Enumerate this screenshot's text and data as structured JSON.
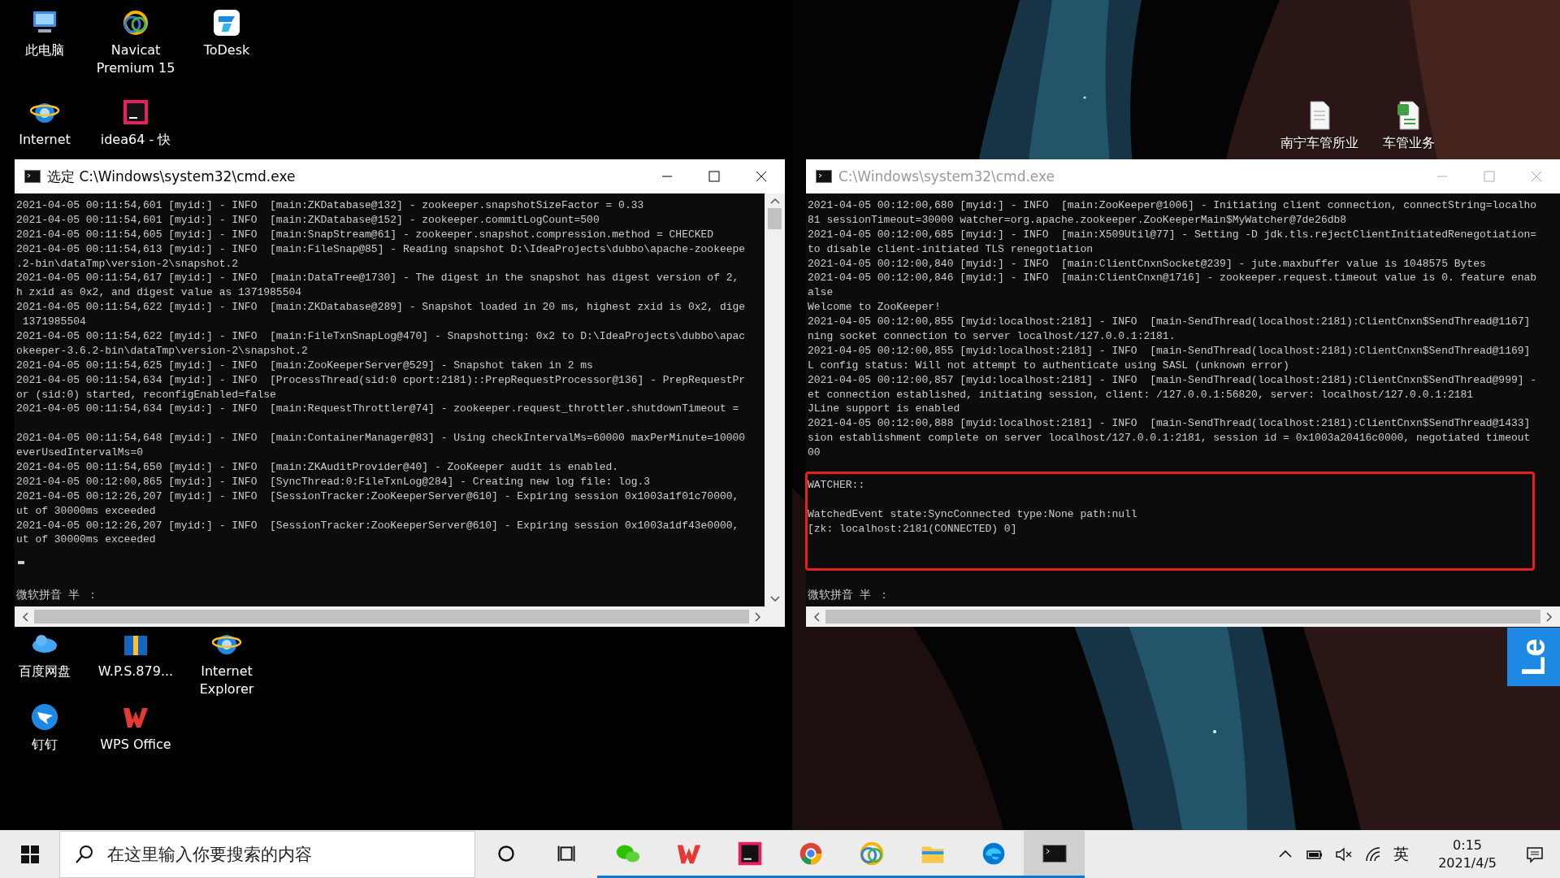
{
  "desktop_icons": [
    {
      "label": "此电脑",
      "kind": "computer"
    },
    {
      "label": "Navicat Premium 15",
      "kind": "rings"
    },
    {
      "label": "ToDesk",
      "kind": "tile"
    },
    {
      "label": "Internet",
      "kind": "globe"
    },
    {
      "label": "idea64 - 快",
      "kind": "ide"
    },
    {
      "label": "南宁车管所业",
      "kind": "document"
    },
    {
      "label": "车管业务",
      "kind": "sheet"
    },
    {
      "label": "百度网盘",
      "kind": "cloud"
    },
    {
      "label": "W.P.S.879...",
      "kind": "package"
    },
    {
      "label": "Internet Explorer",
      "kind": "globe"
    },
    {
      "label": "钉钉",
      "kind": "bird"
    },
    {
      "label": "WPS Office",
      "kind": "wmark"
    }
  ],
  "windows": [
    {
      "title": "选定 C:\\Windows\\system32\\cmd.exe",
      "active": true,
      "vertical_scrollbar": true,
      "cursor": true,
      "blocks": [
        [
          "2021-04-05 00:11:54,601 [myid:] - INFO  [main:ZKDatabase@132] - zookeeper.snapshotSizeFactor = 0.33",
          "2021-04-05 00:11:54,601 [myid:] - INFO  [main:ZKDatabase@152] - zookeeper.commitLogCount=500",
          "2021-04-05 00:11:54,605 [myid:] - INFO  [main:SnapStream@61] - zookeeper.snapshot.compression.method = CHECKED",
          "2021-04-05 00:11:54,613 [myid:] - INFO  [main:FileSnap@85] - Reading snapshot D:\\IdeaProjects\\dubbo\\apache-zookeepe",
          ".2-bin\\dataTmp\\version-2\\snapshot.2",
          "2021-04-05 00:11:54,617 [myid:] - INFO  [main:DataTree@1730] - The digest in the snapshot has digest version of 2,",
          "h zxid as 0x2, and digest value as 1371985504",
          "2021-04-05 00:11:54,622 [myid:] - INFO  [main:ZKDatabase@289] - Snapshot loaded in 20 ms, highest zxid is 0x2, dige",
          " 1371985504",
          "2021-04-05 00:11:54,622 [myid:] - INFO  [main:FileTxnSnapLog@470] - Snapshotting: 0x2 to D:\\IdeaProjects\\dubbo\\apac",
          "okeeper-3.6.2-bin\\dataTmp\\version-2\\snapshot.2",
          "2021-04-05 00:11:54,625 [myid:] - INFO  [main:ZooKeeperServer@529] - Snapshot taken in 2 ms",
          "2021-04-05 00:11:54,634 [myid:] - INFO  [ProcessThread(sid:0 cport:2181)::PrepRequestProcessor@136] - PrepRequestPr",
          "or (sid:0) started, reconfigEnabled=false",
          "2021-04-05 00:11:54,634 [myid:] - INFO  [main:RequestThrottler@74] - zookeeper.request_throttler.shutdownTimeout ="
        ],
        [
          "2021-04-05 00:11:54,648 [myid:] - INFO  [main:ContainerManager@83] - Using checkIntervalMs=60000 maxPerMinute=10000",
          "everUsedIntervalMs=0",
          "2021-04-05 00:11:54,650 [myid:] - INFO  [main:ZKAuditProvider@40] - ZooKeeper audit is enabled.",
          "2021-04-05 00:12:00,865 [myid:] - INFO  [SyncThread:0:FileTxnLog@284] - Creating new log file: log.3",
          "2021-04-05 00:12:26,207 [myid:] - INFO  [SessionTracker:ZooKeeperServer@610] - Expiring session 0x1003a1f01c70000,",
          "ut of 30000ms exceeded",
          "2021-04-05 00:12:26,207 [myid:] - INFO  [SessionTracker:ZooKeeperServer@610] - Expiring session 0x1003a1df43e0000,",
          "ut of 30000ms exceeded"
        ]
      ],
      "ime_status": "微软拼音 半 ："
    },
    {
      "title": "C:\\Windows\\system32\\cmd.exe",
      "active": false,
      "blocks": [
        [
          "2021-04-05 00:12:00,680 [myid:] - INFO  [main:ZooKeeper@1006] - Initiating client connection, connectString=localho",
          "81 sessionTimeout=30000 watcher=org.apache.zookeeper.ZooKeeperMain$MyWatcher@7de26db8",
          "2021-04-05 00:12:00,685 [myid:] - INFO  [main:X509Util@77] - Setting -D jdk.tls.rejectClientInitiatedRenegotiation=",
          "to disable client-initiated TLS renegotiation",
          "2021-04-05 00:12:00,840 [myid:] - INFO  [main:ClientCnxnSocket@239] - jute.maxbuffer value is 1048575 Bytes",
          "2021-04-05 00:12:00,846 [myid:] - INFO  [main:ClientCnxn@1716] - zookeeper.request.timeout value is 0. feature enab",
          "alse",
          "Welcome to ZooKeeper!",
          "2021-04-05 00:12:00,855 [myid:localhost:2181] - INFO  [main-SendThread(localhost:2181):ClientCnxn$SendThread@1167]",
          "ning socket connection to server localhost/127.0.0.1:2181.",
          "2021-04-05 00:12:00,855 [myid:localhost:2181] - INFO  [main-SendThread(localhost:2181):ClientCnxn$SendThread@1169]",
          "L config status: Will not attempt to authenticate using SASL (unknown error)",
          "2021-04-05 00:12:00,857 [myid:localhost:2181] - INFO  [main-SendThread(localhost:2181):ClientCnxn$SendThread@999] -",
          "et connection established, initiating session, client: /127.0.0.1:56820, server: localhost/127.0.0.1:2181",
          "JLine support is enabled",
          "2021-04-05 00:12:00,888 [myid:localhost:2181] - INFO  [main-SendThread(localhost:2181):ClientCnxn$SendThread@1433]",
          "sion establishment complete on server localhost/127.0.0.1:2181, session id = 0x1003a20416c0000, negotiated timeout",
          "00"
        ]
      ],
      "highlight": {
        "blocks": [
          [
            "WATCHER::"
          ],
          [
            "WatchedEvent state:SyncConnected type:None path:null",
            "[zk: localhost:2181(CONNECTED) 0]"
          ]
        ]
      },
      "ime_status": "微软拼音 半 ："
    }
  ],
  "side_tab": {
    "label": "Le"
  },
  "taskbar": {
    "search": {
      "placeholder": "在这里输入你要搜索的内容"
    },
    "apps": [
      {
        "kind": "cortana",
        "running": false,
        "active": false
      },
      {
        "kind": "taskview",
        "running": false,
        "active": false
      },
      {
        "kind": "chat",
        "running": true,
        "active": false
      },
      {
        "kind": "wmark",
        "running": true,
        "active": false
      },
      {
        "kind": "ide",
        "running": true,
        "active": false
      },
      {
        "kind": "browser",
        "running": true,
        "active": false
      },
      {
        "kind": "rings",
        "running": true,
        "active": false
      },
      {
        "kind": "folder",
        "running": true,
        "active": false
      },
      {
        "kind": "swirl",
        "running": true,
        "active": false
      },
      {
        "kind": "terminal",
        "running": true,
        "active": true
      }
    ],
    "tray": {
      "muted": true,
      "language": "英",
      "time": "0:15",
      "date": "2021/4/5"
    }
  }
}
